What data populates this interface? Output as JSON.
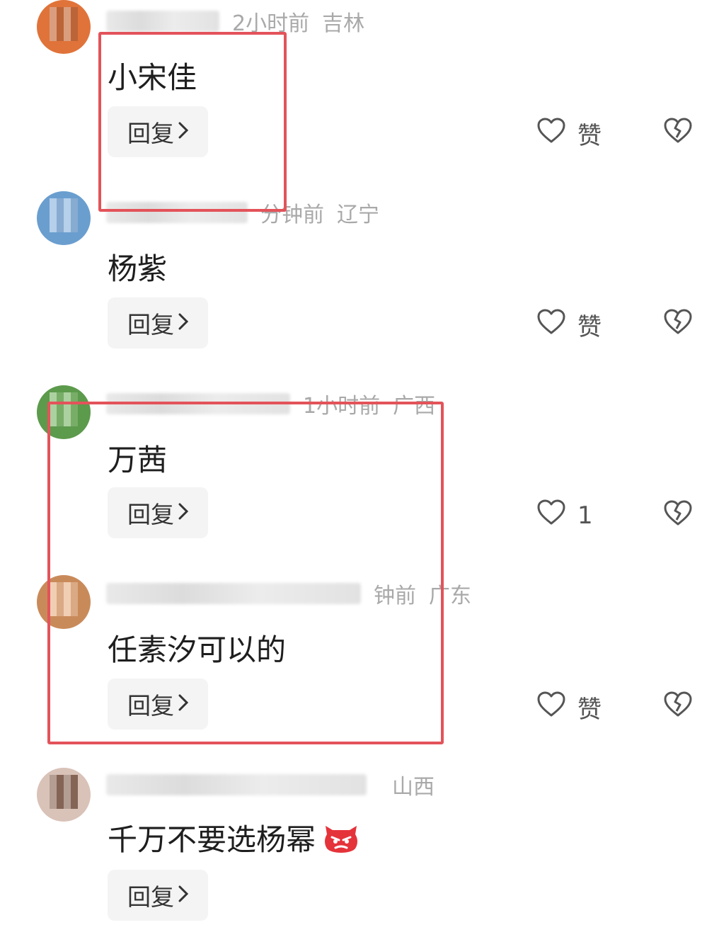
{
  "comments": [
    {
      "time": "2小时前",
      "location": "吉林",
      "text": "小宋佳",
      "reply_label": "回复",
      "like_label": "赞",
      "avatar_color": "#e0733a"
    },
    {
      "time": "分钟前",
      "location": "辽宁",
      "text": "杨紫",
      "reply_label": "回复",
      "like_label": "赞",
      "avatar_color": "#6a9ecf"
    },
    {
      "time": "1小时前",
      "location": "广西",
      "text": "万茜",
      "reply_label": "回复",
      "like_label": "1",
      "avatar_color": "#5c9a4c"
    },
    {
      "time": "钟前",
      "location": "广东",
      "text": "任素汐可以的",
      "reply_label": "回复",
      "like_label": "赞",
      "avatar_color": "#c98a5a"
    },
    {
      "time": "",
      "location": "山西",
      "text": "千万不要选杨幂",
      "reply_label": "回复",
      "avatar_color": "#d9c2b8"
    }
  ],
  "colors": {
    "highlight_box": "#e3535a",
    "meta_text": "#a9a9a9",
    "reply_bg": "#f4f4f4"
  },
  "icons": [
    "heart-outline-icon",
    "broken-heart-icon",
    "chevron-right-icon",
    "angry-face-emoji"
  ]
}
